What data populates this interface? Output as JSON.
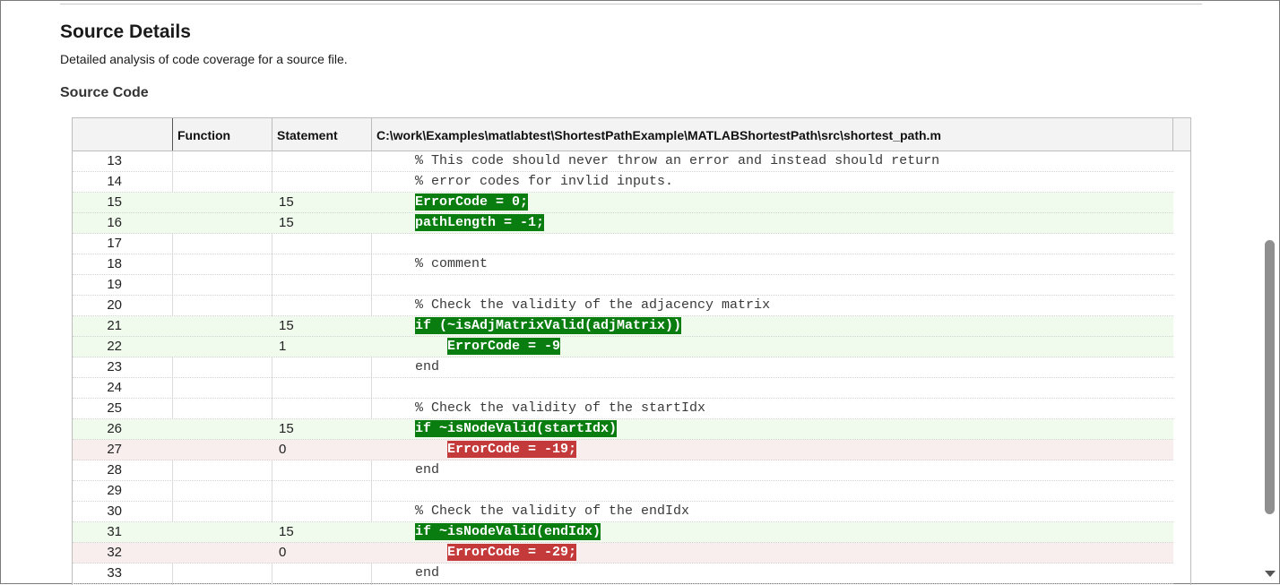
{
  "page": {
    "title": "Source Details",
    "description": "Detailed analysis of code coverage for a source file.",
    "section_title": "Source Code"
  },
  "table": {
    "headers": {
      "function": "Function",
      "statement": "Statement",
      "file_path": "C:\\work\\Examples\\matlabtest\\ShortestPathExample\\MATLABShortestPath\\src\\shortest_path.m"
    },
    "rows": [
      {
        "line": "13",
        "statement": "",
        "status": "none",
        "indent": "",
        "code": "% This code should never throw an error and instead should return"
      },
      {
        "line": "14",
        "statement": "",
        "status": "none",
        "indent": "",
        "code": "% error codes for invlid inputs."
      },
      {
        "line": "15",
        "statement": "15",
        "status": "covered",
        "indent": "",
        "code": "ErrorCode = 0;"
      },
      {
        "line": "16",
        "statement": "15",
        "status": "covered",
        "indent": "",
        "code": "pathLength = -1;"
      },
      {
        "line": "17",
        "statement": "",
        "status": "none",
        "indent": "",
        "code": ""
      },
      {
        "line": "18",
        "statement": "",
        "status": "none",
        "indent": "",
        "code": "% comment"
      },
      {
        "line": "19",
        "statement": "",
        "status": "none",
        "indent": "",
        "code": ""
      },
      {
        "line": "20",
        "statement": "",
        "status": "none",
        "indent": "",
        "code": "% Check the validity of the adjacency matrix"
      },
      {
        "line": "21",
        "statement": "15",
        "status": "covered",
        "indent": "",
        "code": "if (~isAdjMatrixValid(adjMatrix))"
      },
      {
        "line": "22",
        "statement": "1",
        "status": "covered",
        "indent": "    ",
        "code": "ErrorCode = -9"
      },
      {
        "line": "23",
        "statement": "",
        "status": "none",
        "indent": "",
        "code": "end"
      },
      {
        "line": "24",
        "statement": "",
        "status": "none",
        "indent": "",
        "code": ""
      },
      {
        "line": "25",
        "statement": "",
        "status": "none",
        "indent": "",
        "code": "% Check the validity of the startIdx"
      },
      {
        "line": "26",
        "statement": "15",
        "status": "covered",
        "indent": "",
        "code": "if ~isNodeValid(startIdx)"
      },
      {
        "line": "27",
        "statement": "0",
        "status": "missed",
        "indent": "    ",
        "code": "ErrorCode = -19;"
      },
      {
        "line": "28",
        "statement": "",
        "status": "none",
        "indent": "",
        "code": "end"
      },
      {
        "line": "29",
        "statement": "",
        "status": "none",
        "indent": "",
        "code": ""
      },
      {
        "line": "30",
        "statement": "",
        "status": "none",
        "indent": "",
        "code": "% Check the validity of the endIdx"
      },
      {
        "line": "31",
        "statement": "15",
        "status": "covered",
        "indent": "",
        "code": "if ~isNodeValid(endIdx)"
      },
      {
        "line": "32",
        "statement": "0",
        "status": "missed",
        "indent": "    ",
        "code": "ErrorCode = -29;"
      },
      {
        "line": "33",
        "statement": "",
        "status": "none",
        "indent": "",
        "code": "end"
      }
    ]
  },
  "colors": {
    "covered_row_bg": "#f0fbee",
    "covered_highlight": "#0a7d10",
    "missed_row_bg": "#f9eeee",
    "missed_highlight": "#c43a3a"
  },
  "icons": {
    "table_scroll_up": "triangle-up-icon",
    "page_scroll_down": "triangle-down-icon"
  }
}
